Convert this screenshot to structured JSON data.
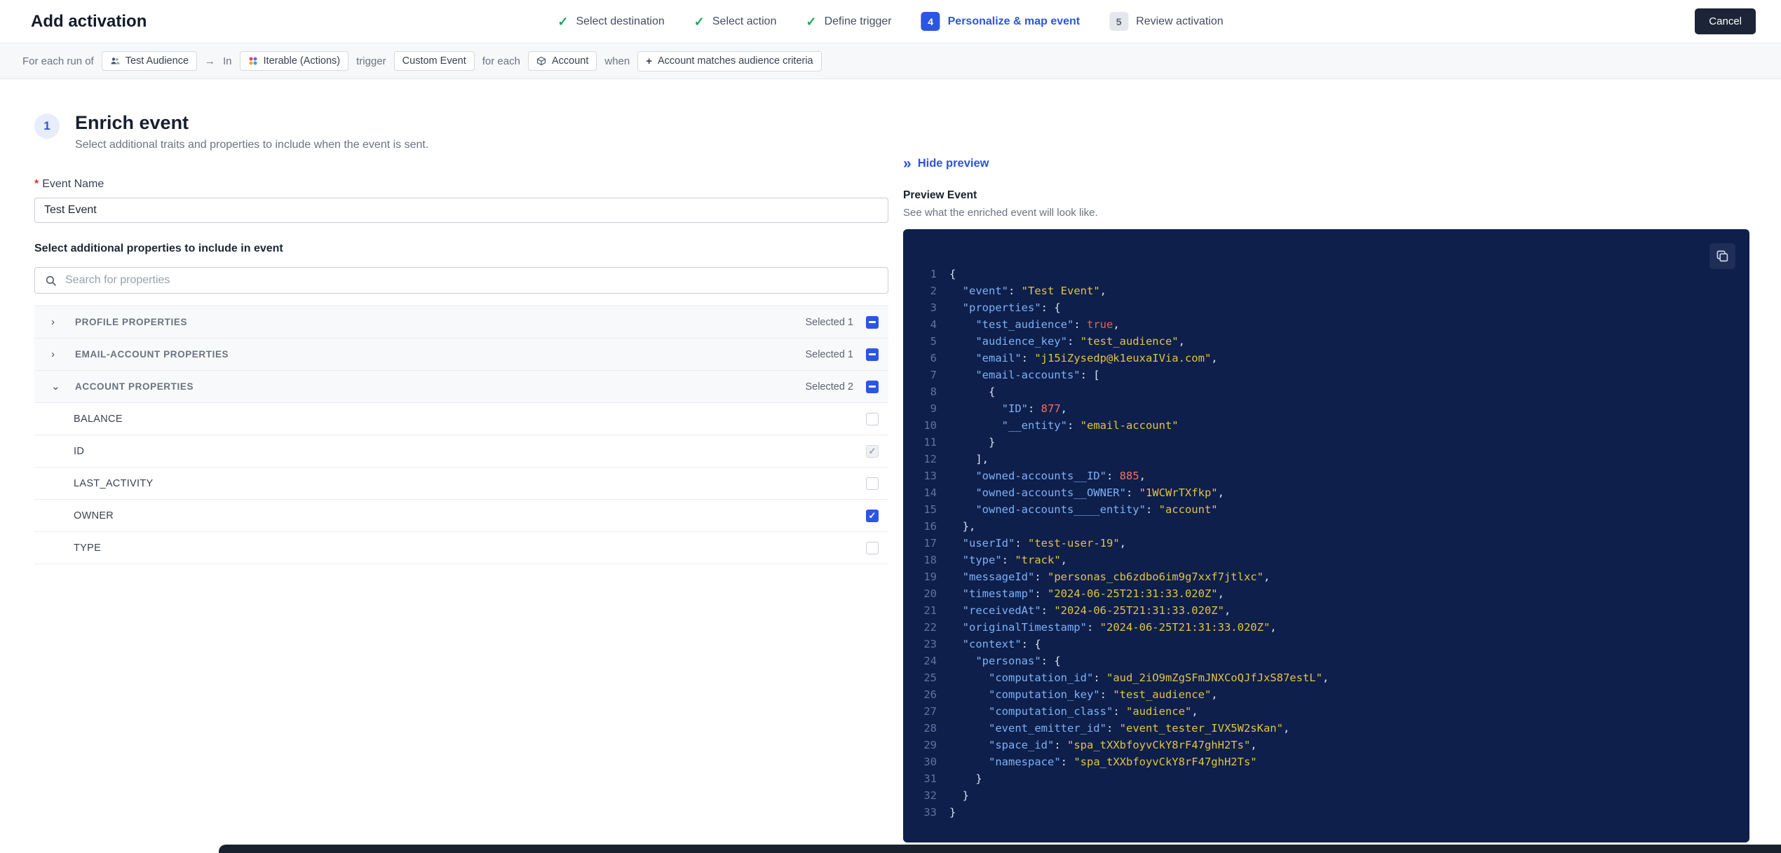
{
  "header": {
    "title": "Add activation",
    "cancel_label": "Cancel",
    "steps": [
      {
        "label": "Select destination",
        "state": "done"
      },
      {
        "label": "Select action",
        "state": "done"
      },
      {
        "label": "Define trigger",
        "state": "done"
      },
      {
        "label": "Personalize & map event",
        "state": "active",
        "number": "4"
      },
      {
        "label": "Review activation",
        "state": "upcoming",
        "number": "5"
      }
    ]
  },
  "icons": {
    "check": "✓",
    "chevron_right": "›",
    "chevron_down": "⌄",
    "plus": "+",
    "arrow": "→",
    "double_chevron": "»"
  },
  "trigger_bar": {
    "segments": [
      {
        "type": "text",
        "text": "For each run of"
      },
      {
        "type": "chip",
        "text": "Test Audience",
        "icon": "audience-icon"
      },
      {
        "type": "text",
        "text": "→",
        "icon": "arrow-right-icon"
      },
      {
        "type": "text",
        "text": "In"
      },
      {
        "type": "chip",
        "text": "Iterable (Actions)",
        "icon": "destination-icon"
      },
      {
        "type": "text",
        "text": "trigger"
      },
      {
        "type": "chip",
        "text": "Custom Event"
      },
      {
        "type": "text",
        "text": "for each"
      },
      {
        "type": "chip",
        "text": "Account",
        "icon": "entity-icon"
      },
      {
        "type": "text",
        "text": "when"
      },
      {
        "type": "chip",
        "text": "Account matches audience criteria",
        "plus": true
      }
    ]
  },
  "enrich": {
    "step_number": "1",
    "title": "Enrich event",
    "subtitle": "Select additional traits and properties to include when the event is sent.",
    "required_marker": "*",
    "event_name_label": "Event Name",
    "event_name_value": "Test Event",
    "properties_label": "Select additional properties to include in event",
    "search_placeholder": "Search for properties",
    "sections": [
      {
        "label": "PROFILE PROPERTIES",
        "selected": "Selected 1",
        "expanded": false,
        "children": []
      },
      {
        "label": "EMAIL-ACCOUNT PROPERTIES",
        "selected": "Selected 1",
        "expanded": false,
        "children": []
      },
      {
        "label": "ACCOUNT PROPERTIES",
        "selected": "Selected 2",
        "expanded": true,
        "children": [
          {
            "label": "BALANCE",
            "checked": false,
            "disabled": false
          },
          {
            "label": "ID",
            "checked": true,
            "disabled": true
          },
          {
            "label": "LAST_ACTIVITY",
            "checked": false,
            "disabled": false
          },
          {
            "label": "OWNER",
            "checked": true,
            "disabled": false
          },
          {
            "label": "TYPE",
            "checked": false,
            "disabled": false
          }
        ]
      }
    ]
  },
  "preview": {
    "hide_label": "Hide preview",
    "title": "Preview Event",
    "subtitle": "See what the enriched event will look like.",
    "code_lines": [
      [
        [
          "pl",
          "{"
        ]
      ],
      [
        [
          "pl",
          "  "
        ],
        [
          "k",
          "\"event\""
        ],
        [
          "pl",
          ": "
        ],
        [
          "s",
          "\"Test Event\""
        ],
        [
          "pl",
          ","
        ]
      ],
      [
        [
          "pl",
          "  "
        ],
        [
          "k",
          "\"properties\""
        ],
        [
          "pl",
          ": {"
        ]
      ],
      [
        [
          "pl",
          "    "
        ],
        [
          "k",
          "\"test_audience\""
        ],
        [
          "pl",
          ": "
        ],
        [
          "b",
          "true"
        ],
        [
          "pl",
          ","
        ]
      ],
      [
        [
          "pl",
          "    "
        ],
        [
          "k",
          "\"audience_key\""
        ],
        [
          "pl",
          ": "
        ],
        [
          "s",
          "\"test_audience\""
        ],
        [
          "pl",
          ","
        ]
      ],
      [
        [
          "pl",
          "    "
        ],
        [
          "k",
          "\"email\""
        ],
        [
          "pl",
          ": "
        ],
        [
          "s",
          "\"j15iZysedp@k1euxaIVia.com\""
        ],
        [
          "pl",
          ","
        ]
      ],
      [
        [
          "pl",
          "    "
        ],
        [
          "k",
          "\"email-accounts\""
        ],
        [
          "pl",
          ": ["
        ]
      ],
      [
        [
          "pl",
          "      {"
        ]
      ],
      [
        [
          "pl",
          "        "
        ],
        [
          "k",
          "\"ID\""
        ],
        [
          "pl",
          ": "
        ],
        [
          "n",
          "877"
        ],
        [
          "pl",
          ","
        ]
      ],
      [
        [
          "pl",
          "        "
        ],
        [
          "k",
          "\"__entity\""
        ],
        [
          "pl",
          ": "
        ],
        [
          "s",
          "\"email-account\""
        ]
      ],
      [
        [
          "pl",
          "      }"
        ]
      ],
      [
        [
          "pl",
          "    ],"
        ]
      ],
      [
        [
          "pl",
          "    "
        ],
        [
          "k",
          "\"owned-accounts__ID\""
        ],
        [
          "pl",
          ": "
        ],
        [
          "n",
          "885"
        ],
        [
          "pl",
          ","
        ]
      ],
      [
        [
          "pl",
          "    "
        ],
        [
          "k",
          "\"owned-accounts__OWNER\""
        ],
        [
          "pl",
          ": "
        ],
        [
          "s",
          "\"1WCWrTXfkp\""
        ],
        [
          "pl",
          ","
        ]
      ],
      [
        [
          "pl",
          "    "
        ],
        [
          "k",
          "\"owned-accounts____entity\""
        ],
        [
          "pl",
          ": "
        ],
        [
          "s",
          "\"account\""
        ]
      ],
      [
        [
          "pl",
          "  },"
        ]
      ],
      [
        [
          "pl",
          "  "
        ],
        [
          "k",
          "\"userId\""
        ],
        [
          "pl",
          ": "
        ],
        [
          "s",
          "\"test-user-19\""
        ],
        [
          "pl",
          ","
        ]
      ],
      [
        [
          "pl",
          "  "
        ],
        [
          "k",
          "\"type\""
        ],
        [
          "pl",
          ": "
        ],
        [
          "s",
          "\"track\""
        ],
        [
          "pl",
          ","
        ]
      ],
      [
        [
          "pl",
          "  "
        ],
        [
          "k",
          "\"messageId\""
        ],
        [
          "pl",
          ": "
        ],
        [
          "s",
          "\"personas_cb6zdbo6im9g7xxf7jtlxc\""
        ],
        [
          "pl",
          ","
        ]
      ],
      [
        [
          "pl",
          "  "
        ],
        [
          "k",
          "\"timestamp\""
        ],
        [
          "pl",
          ": "
        ],
        [
          "s",
          "\"2024-06-25T21:31:33.020Z\""
        ],
        [
          "pl",
          ","
        ]
      ],
      [
        [
          "pl",
          "  "
        ],
        [
          "k",
          "\"receivedAt\""
        ],
        [
          "pl",
          ": "
        ],
        [
          "s",
          "\"2024-06-25T21:31:33.020Z\""
        ],
        [
          "pl",
          ","
        ]
      ],
      [
        [
          "pl",
          "  "
        ],
        [
          "k",
          "\"originalTimestamp\""
        ],
        [
          "pl",
          ": "
        ],
        [
          "s",
          "\"2024-06-25T21:31:33.020Z\""
        ],
        [
          "pl",
          ","
        ]
      ],
      [
        [
          "pl",
          "  "
        ],
        [
          "k",
          "\"context\""
        ],
        [
          "pl",
          ": {"
        ]
      ],
      [
        [
          "pl",
          "    "
        ],
        [
          "k",
          "\"personas\""
        ],
        [
          "pl",
          ": {"
        ]
      ],
      [
        [
          "pl",
          "      "
        ],
        [
          "k",
          "\"computation_id\""
        ],
        [
          "pl",
          ": "
        ],
        [
          "s",
          "\"aud_2iO9mZgSFmJNXCoQJfJxS87estL\""
        ],
        [
          "pl",
          ","
        ]
      ],
      [
        [
          "pl",
          "      "
        ],
        [
          "k",
          "\"computation_key\""
        ],
        [
          "pl",
          ": "
        ],
        [
          "s",
          "\"test_audience\""
        ],
        [
          "pl",
          ","
        ]
      ],
      [
        [
          "pl",
          "      "
        ],
        [
          "k",
          "\"computation_class\""
        ],
        [
          "pl",
          ": "
        ],
        [
          "s",
          "\"audience\""
        ],
        [
          "pl",
          ","
        ]
      ],
      [
        [
          "pl",
          "      "
        ],
        [
          "k",
          "\"event_emitter_id\""
        ],
        [
          "pl",
          ": "
        ],
        [
          "s",
          "\"event_tester_IVX5W2sKan\""
        ],
        [
          "pl",
          ","
        ]
      ],
      [
        [
          "pl",
          "      "
        ],
        [
          "k",
          "\"space_id\""
        ],
        [
          "pl",
          ": "
        ],
        [
          "s",
          "\"spa_tXXbfoyvCkY8rF47ghH2Ts\""
        ],
        [
          "pl",
          ","
        ]
      ],
      [
        [
          "pl",
          "      "
        ],
        [
          "k",
          "\"namespace\""
        ],
        [
          "pl",
          ": "
        ],
        [
          "s",
          "\"spa_tXXbfoyvCkY8rF47ghH2Ts\""
        ]
      ],
      [
        [
          "pl",
          "    }"
        ]
      ],
      [
        [
          "pl",
          "  }"
        ]
      ],
      [
        [
          "pl",
          "}"
        ]
      ]
    ]
  }
}
